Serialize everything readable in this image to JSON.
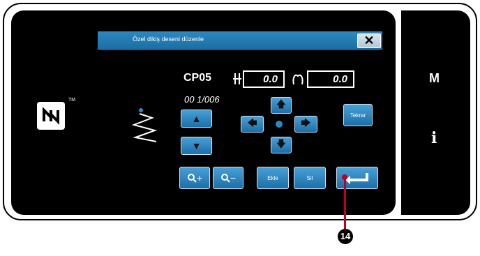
{
  "dialog": {
    "title": "Özel dikiş deseni düzenle",
    "close_label": "✕"
  },
  "pattern": {
    "number": "CP05",
    "x_value": "0.0",
    "y_value": "0.0",
    "step_counter": "00 1/006"
  },
  "buttons": {
    "up": "▲",
    "down": "▼",
    "arrow_up": "🡅",
    "arrow_down": "🡇",
    "arrow_left": "🡄",
    "arrow_right": "🡆",
    "repeat": "Tekrar",
    "zoom_in": "+",
    "zoom_out": "−",
    "add": "Ekle",
    "delete": "Sil",
    "enter": "↵"
  },
  "side_panel": {
    "m_label": "M",
    "info_label": "i"
  },
  "callout": {
    "number": "14"
  },
  "colors": {
    "accent": "#2c89c0",
    "callout": "#c0001e"
  },
  "icons": {
    "nfc": "nfc-logo-icon",
    "stitch": "zigzag-stitch-icon",
    "magnify": "magnifier-icon"
  }
}
